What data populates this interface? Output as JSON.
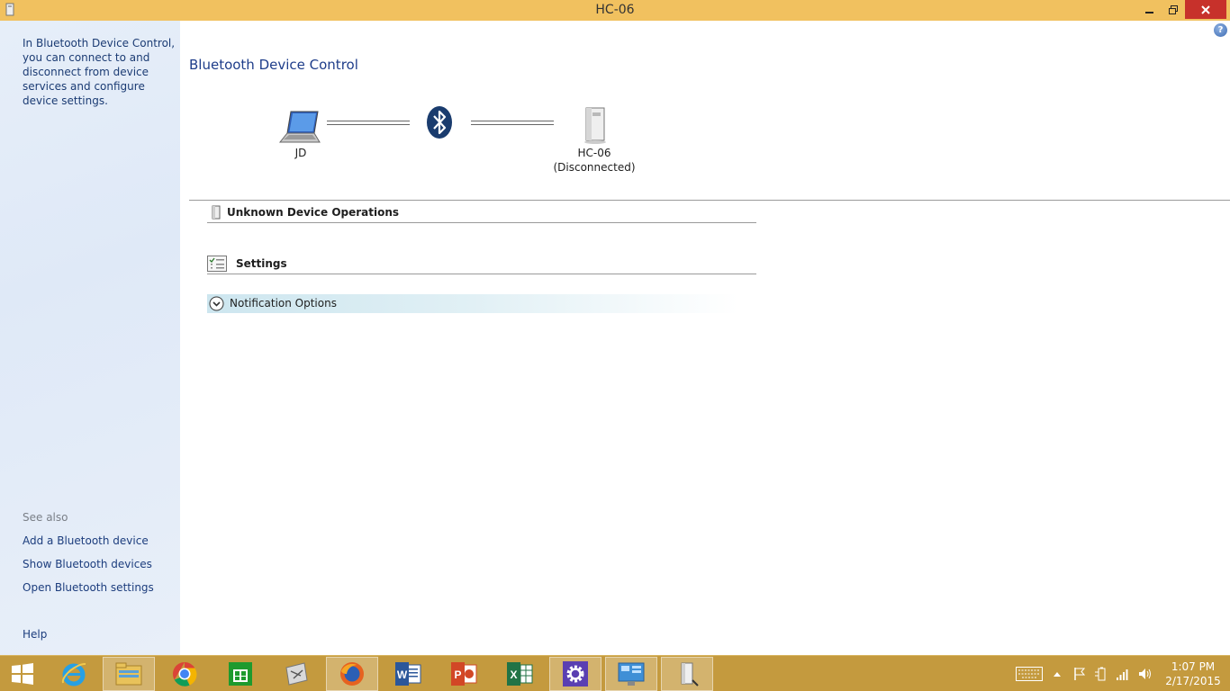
{
  "window": {
    "title": "HC-06"
  },
  "left_pane": {
    "intro": "In Bluetooth Device Control, you can connect to and disconnect from device services and configure device settings.",
    "see_also_heading": "See also",
    "links": [
      "Add a Bluetooth device",
      "Show Bluetooth devices",
      "Open Bluetooth settings"
    ],
    "help": "Help"
  },
  "main": {
    "title": "Bluetooth Device Control",
    "local_device": {
      "name": "JD"
    },
    "remote_device": {
      "name": "HC-06",
      "status": "(Disconnected)"
    },
    "sections": {
      "unknown_ops": "Unknown Device Operations",
      "settings": "Settings",
      "notification": "Notification Options"
    }
  },
  "taskbar": {
    "apps": [
      "start",
      "internet-explorer",
      "file-explorer",
      "chrome",
      "store",
      "scanner-app",
      "firefox",
      "word",
      "powerpoint",
      "excel",
      "settings",
      "control-panel",
      "bluetooth-device"
    ],
    "active_apps": [
      "file-explorer",
      "firefox",
      "settings",
      "control-panel",
      "bluetooth-device"
    ],
    "clock": {
      "time": "1:07 PM",
      "date": "2/17/2015"
    }
  }
}
